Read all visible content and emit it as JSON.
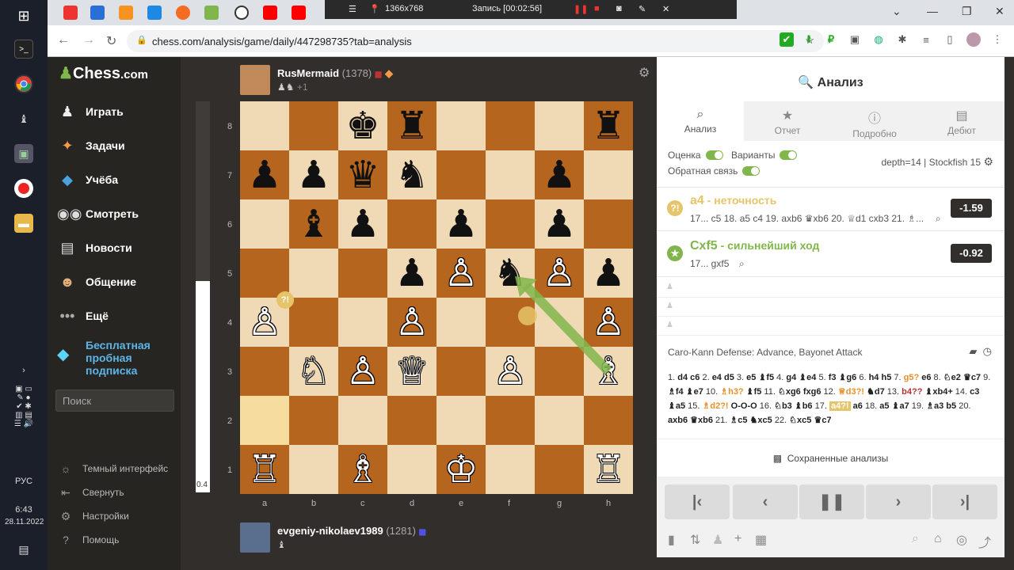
{
  "recorder": {
    "resolution": "1366x768",
    "status": "Запись [00:02:56]"
  },
  "browser": {
    "url": "chess.com/analysis/game/daily/447298735?tab=analysis"
  },
  "taskbar": {
    "lang": "РУС",
    "time": "6:43",
    "date": "28.11.2022"
  },
  "logo": {
    "text": "Chess",
    "suffix": ".com"
  },
  "sidebar": {
    "items": [
      {
        "label": "Играть"
      },
      {
        "label": "Задачи"
      },
      {
        "label": "Учёба"
      },
      {
        "label": "Смотреть"
      },
      {
        "label": "Новости"
      },
      {
        "label": "Общение"
      },
      {
        "label": "Ещё"
      }
    ],
    "trial_l1": "Бесплатная",
    "trial_l2": "пробная",
    "trial_l3": "подписка",
    "search_placeholder": "Поиск",
    "bottom": [
      {
        "label": "Темный интерфейс"
      },
      {
        "label": "Свернуть"
      },
      {
        "label": "Настройки"
      },
      {
        "label": "Помощь"
      }
    ]
  },
  "top_player": {
    "name": "RusMermaid",
    "rating": "(1378)",
    "captured": "+1"
  },
  "bottom_player": {
    "name": "evgeniy-nikolaev1989",
    "rating": "(1281)"
  },
  "eval_bar": {
    "value": "0.4",
    "white_fraction": 0.54
  },
  "board": {
    "ranks": [
      "8",
      "7",
      "6",
      "5",
      "4",
      "3",
      "2",
      "1"
    ],
    "files": [
      "a",
      "b",
      "c",
      "d",
      "e",
      "f",
      "g",
      "h"
    ],
    "highlight": [
      "a2"
    ],
    "pieces": [
      {
        "sq": "c8",
        "p": "♚",
        "c": "b"
      },
      {
        "sq": "d8",
        "p": "♜",
        "c": "b"
      },
      {
        "sq": "h8",
        "p": "♜",
        "c": "b"
      },
      {
        "sq": "a7",
        "p": "♟",
        "c": "b"
      },
      {
        "sq": "b7",
        "p": "♟",
        "c": "b"
      },
      {
        "sq": "c7",
        "p": "♛",
        "c": "b"
      },
      {
        "sq": "d7",
        "p": "♞",
        "c": "b"
      },
      {
        "sq": "g7",
        "p": "♟",
        "c": "b"
      },
      {
        "sq": "b6",
        "p": "♝",
        "c": "b"
      },
      {
        "sq": "c6",
        "p": "♟",
        "c": "b"
      },
      {
        "sq": "e6",
        "p": "♟",
        "c": "b"
      },
      {
        "sq": "g6",
        "p": "♟",
        "c": "b"
      },
      {
        "sq": "d5",
        "p": "♟",
        "c": "b"
      },
      {
        "sq": "e5",
        "p": "♙",
        "c": "w"
      },
      {
        "sq": "f5",
        "p": "♞",
        "c": "b"
      },
      {
        "sq": "g5",
        "p": "♙",
        "c": "w"
      },
      {
        "sq": "h5",
        "p": "♟",
        "c": "b"
      },
      {
        "sq": "a4",
        "p": "♙",
        "c": "w"
      },
      {
        "sq": "d4",
        "p": "♙",
        "c": "w"
      },
      {
        "sq": "h4",
        "p": "♙",
        "c": "w"
      },
      {
        "sq": "b3",
        "p": "♘",
        "c": "w"
      },
      {
        "sq": "c3",
        "p": "♙",
        "c": "w"
      },
      {
        "sq": "d3",
        "p": "♕",
        "c": "w"
      },
      {
        "sq": "f3",
        "p": "♙",
        "c": "w"
      },
      {
        "sq": "h3",
        "p": "♗",
        "c": "w"
      },
      {
        "sq": "a1",
        "p": "♖",
        "c": "w"
      },
      {
        "sq": "c1",
        "p": "♗",
        "c": "w"
      },
      {
        "sq": "e1",
        "p": "♔",
        "c": "w"
      },
      {
        "sq": "h1",
        "p": "♖",
        "c": "w"
      }
    ],
    "inaccuracy_badge": "?!"
  },
  "panel": {
    "title": "Анализ",
    "tabs": [
      {
        "label": "Анализ"
      },
      {
        "label": "Отчет"
      },
      {
        "label": "Подробно"
      },
      {
        "label": "Дебют"
      }
    ],
    "toggles": {
      "eval": "Оценка",
      "variants": "Варианты",
      "feedback": "Обратная связь"
    },
    "engine": "depth=14 | Stockfish 15",
    "line1": {
      "move": "a4",
      "desc": " - неточность",
      "variation": "17... c5 18. a5 c4 19. axb6 ♛xb6 20. ♕d1 cxb3 21. ♗...",
      "score": "-1.59"
    },
    "line2": {
      "move": "Cxf5",
      "desc": " - сильнейший ход",
      "variation": "17... gxf5",
      "score": "-0.92"
    },
    "opening": "Caro-Kann Defense: Advance, Bayonet Attack",
    "saved": "Сохраненные анализы"
  },
  "colors": {
    "light_sq": "#f0d9b5",
    "dark_sq": "#b5651d",
    "accent": "#81b64c",
    "inaccuracy": "#e6c46a"
  }
}
